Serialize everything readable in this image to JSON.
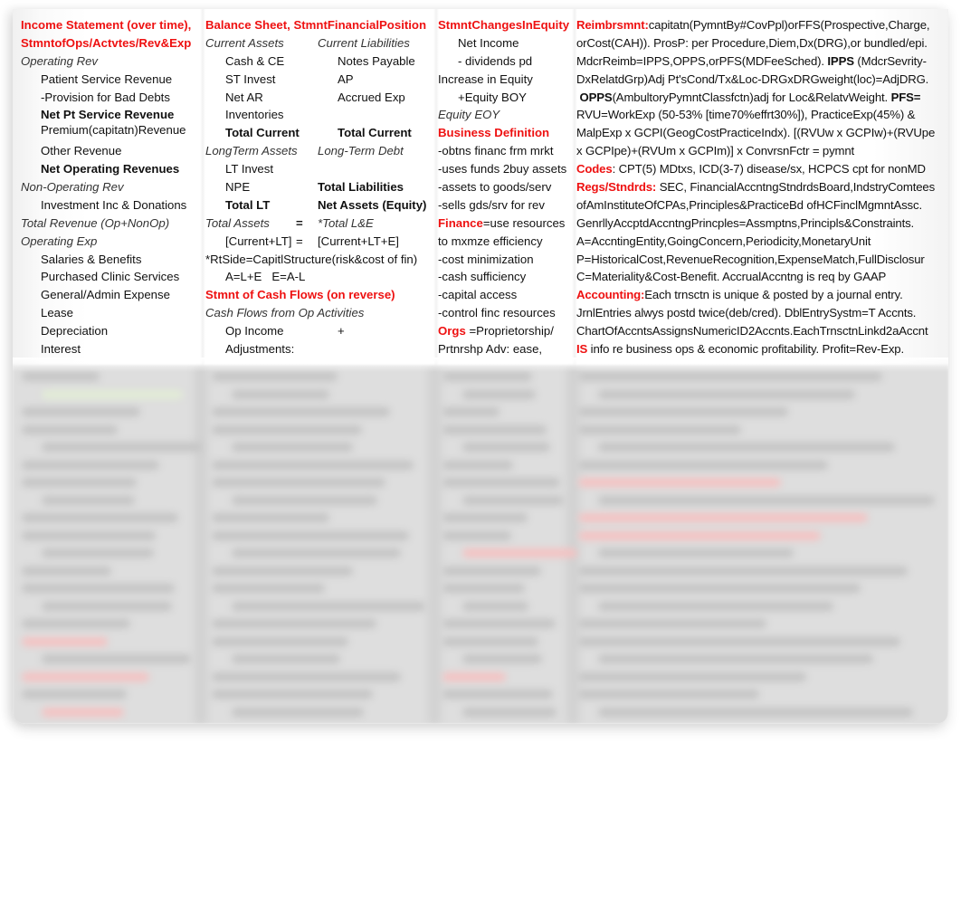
{
  "income_statement": {
    "title_line1": "Income Statement (over time),",
    "title_line2": "StmntofOps/Actvtes/Rev&Exp",
    "operating_rev": "Operating Rev",
    "items_rev": [
      "Patient Service Revenue",
      "-Provision for Bad Debts"
    ],
    "net_pt_service_revenue": "Net Pt Service Revenue",
    "premium_revenue": "Premium(capitatn)Revenue",
    "other_revenue": "Other Revenue",
    "net_operating_revenues": "Net Operating Revenues",
    "non_operating_rev": "Non-Operating Rev",
    "investment_inc": "Investment Inc & Donations",
    "total_revenue": "Total Revenue (Op+NonOp)",
    "operating_exp": "Operating Exp",
    "items_exp": [
      "Salaries & Benefits",
      "Purchased Clinic Services",
      "General/Admin Expense",
      "Lease",
      "Depreciation",
      "Interest"
    ]
  },
  "balance_sheet": {
    "title": "Balance Sheet, StmntFinancialPosition",
    "current_assets": "Current Assets",
    "current_liabilities": "Current Liabilities",
    "rows": [
      [
        "Cash  &  CE",
        "Notes Payable"
      ],
      [
        "ST Invest",
        "AP"
      ],
      [
        "Net AR",
        "Accrued Exp"
      ],
      [
        "Inventories",
        ""
      ]
    ],
    "total_current_left": "Total Current",
    "total_current_right": "Total Current",
    "longterm_assets": "LongTerm Assets",
    "longterm_debt": "Long-Term Debt",
    "lt_invest": "LT Invest",
    "npe": "NPE",
    "total_liabilities": "Total Liabilities",
    "total_lt": "Total LT",
    "net_assets": "Net Assets (Equity)",
    "total_assets": "Total Assets",
    "eq1": "=",
    "total_le": "*Total L&E",
    "current_lt": "[Current+LT]",
    "eq2": "=",
    "current_lt_e": "[Current+LT+E]",
    "rtside": "*RtSide=CapitlStructure(risk&cost of fin)",
    "ale": "A=L+E   E=A-L"
  },
  "cash_flows": {
    "title": "Stmnt of Cash Flows (on reverse)",
    "cf_from_op": "Cash Flows from Op Activities",
    "op_income": "Op Income",
    "plus": "+",
    "adjustments": "Adjustments:"
  },
  "equity": {
    "title": "StmntChangesInEquity",
    "net_income": "Net Income",
    "dividends": "- dividends pd",
    "increase": "Increase in Equity",
    "equity_boy": "+Equity BOY",
    "equity_eoy": "Equity EOY"
  },
  "business": {
    "title": "Business Definition",
    "items": [
      "-obtns financ frm mrkt",
      "-uses funds 2buy assets",
      "-assets to goods/serv",
      "-sells gds/srv for rev"
    ]
  },
  "finance": {
    "label": "Finance",
    "text1": "=use resources",
    "text2": "to mxmze efficiency",
    "items": [
      "-cost minimization",
      "-cash sufficiency",
      "-capital access",
      "-control finc resources"
    ]
  },
  "orgs": {
    "label": "Orgs",
    "text1": " =Proprietorship/",
    "text2": "Prtnrshp Adv: ease,"
  },
  "reimbursement": {
    "label": "Reimbrsmnt:",
    "line1": "capitatn(PymntBy#CovPpl)orFFS(Prospective,Charge,",
    "line2": "orCost(CAH)). ProsP: per Procedure,Diem,Dx(DRG),or bundled/epi.",
    "line3a": "MdcrReimb=IPPS,OPPS,orPFS(MDFeeSched). ",
    "ipps": "IPPS",
    "line3b": " (MdcrSevrity-",
    "line4": "DxRelatdGrp)Adj Pt'sCond/Tx&Loc-DRGxDRGweight(loc)=AdjDRG.",
    "opps": "OPPS",
    "line5a": "(AmbultoryPymntClassfctn)adj for Loc&RelatvWeight. ",
    "pfs": "PFS=",
    "line6": "RVU=WorkExp (50-53% [time70%effrt30%]), PracticeExp(45%) &",
    "line7": "MalpExp x GCPI(GeogCostPracticeIndx). [(RVUw x GCPIw)+(RVUpe",
    "line8": "x GCPIpe)+(RVUm x GCPIm)] x ConvrsnFctr = pymnt"
  },
  "codes": {
    "label": "Codes",
    "text": ": CPT(5) MDtxs, ICD(3-7) disease/sx, HCPCS cpt for nonMD"
  },
  "regs": {
    "label": "Regs/Stndrds:",
    "line1": " SEC, FinancialAccntngStndrdsBoard,IndstryComtees",
    "line2": "ofAmInstituteOfCPAs,Principles&PracticeBd ofHCFinclMgmntAssc.",
    "line3": "GenrllyAccptdAccntngPrincples=Assmptns,Principls&Constraints.",
    "line4": "A=AccntingEntity,GoingConcern,Periodicity,MonetaryUnit",
    "line5": "P=HistoricalCost,RevenueRecognition,ExpenseMatch,FullDisclosur",
    "line6": "C=Materiality&Cost-Benefit. AccrualAccntng is req by GAAP"
  },
  "accounting": {
    "label": "Accounting:",
    "line1": "Each trnsctn is unique & posted by a journal entry.",
    "line2": "JrnlEntries alwys postd twice(deb/cred). DblEntrySystm=T Accnts.",
    "line3": "ChartOfAccntsAssignsNumericID2Accnts.EachTrnsctnLinkd2aAccnt"
  },
  "is_note": {
    "label": "IS",
    "text": " info re business ops & economic profitability. Profit=Rev-Exp."
  },
  "colors": {
    "heading_red": "#ee1111",
    "text": "#111111",
    "blur_overlay": "#dedede"
  }
}
